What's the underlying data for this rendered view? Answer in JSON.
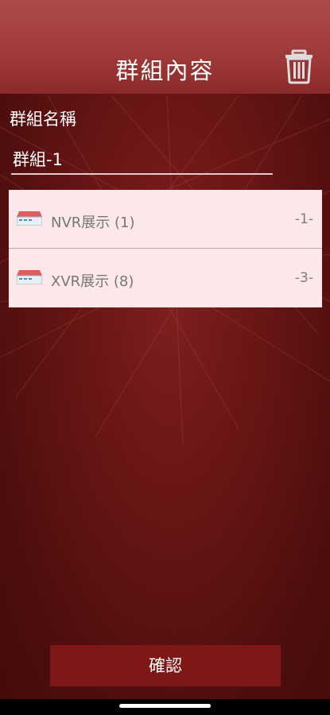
{
  "header": {
    "title": "群組內容",
    "delete_icon": "trash-icon"
  },
  "form": {
    "name_label": "群組名稱",
    "name_value": "群組-1"
  },
  "devices": [
    {
      "name": "NVR展示 (1)",
      "channel": "-1-",
      "icon": "dvr-device-icon"
    },
    {
      "name": "XVR展示 (8)",
      "channel": "-3-",
      "icon": "dvr-device-icon"
    }
  ],
  "footer": {
    "confirm_label": "確認"
  },
  "colors": {
    "topbar": "#9b3535",
    "background": "#6a1616",
    "list_bg": "#fce8ea",
    "button": "#7f1717"
  }
}
